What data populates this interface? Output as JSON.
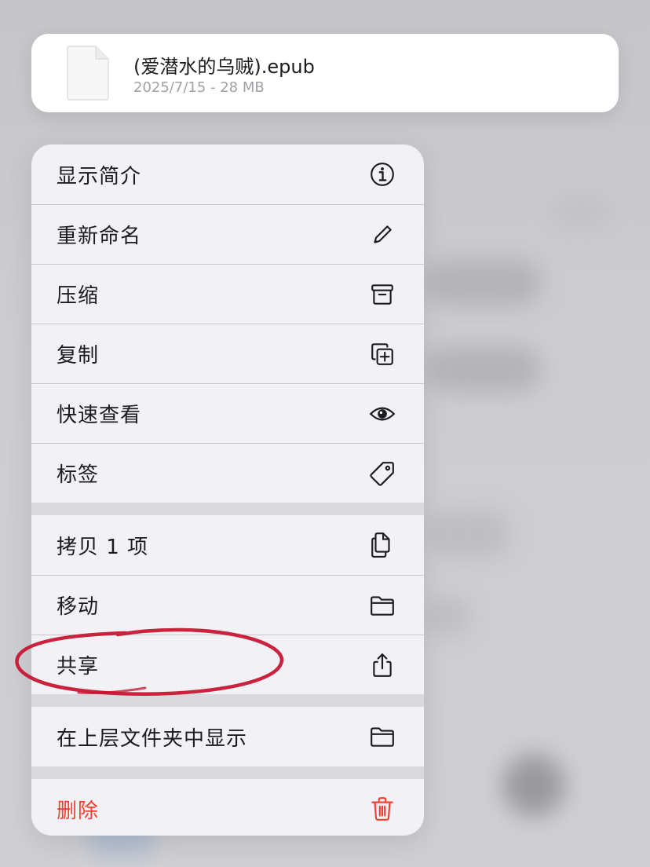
{
  "file": {
    "name": "(爱潜水的乌贼).epub",
    "meta": "2025/7/15 - 28 MB"
  },
  "menu": {
    "group1": [
      {
        "label": "显示简介",
        "icon": "info-icon"
      },
      {
        "label": "重新命名",
        "icon": "pencil-icon"
      },
      {
        "label": "压缩",
        "icon": "archive-box-icon"
      },
      {
        "label": "复制",
        "icon": "duplicate-icon"
      },
      {
        "label": "快速查看",
        "icon": "eye-icon"
      },
      {
        "label": "标签",
        "icon": "tag-icon"
      }
    ],
    "group2": [
      {
        "label": "拷贝 1 项",
        "icon": "copy-doc-icon"
      },
      {
        "label": "移动",
        "icon": "folder-icon"
      },
      {
        "label": "共享",
        "icon": "share-icon"
      }
    ],
    "group3": [
      {
        "label": "在上层文件夹中显示",
        "icon": "folder-icon"
      }
    ],
    "group4": [
      {
        "label": "删除",
        "icon": "trash-icon"
      }
    ]
  },
  "colors": {
    "danger": "#ff3b30",
    "annotation": "#c8102e"
  }
}
